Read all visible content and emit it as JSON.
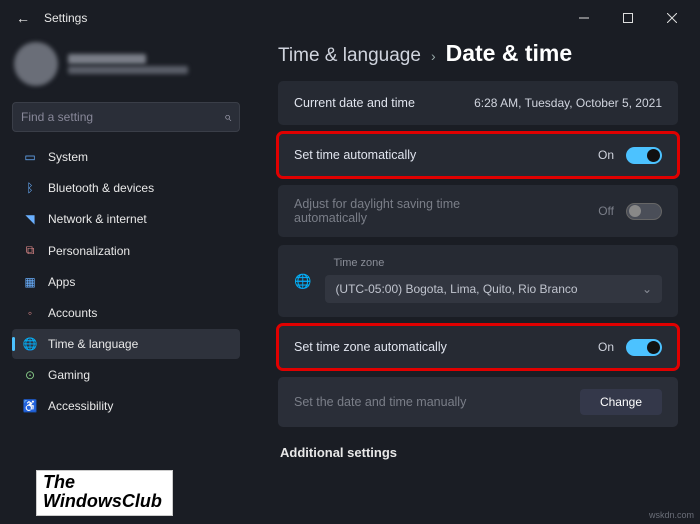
{
  "window": {
    "title": "Settings"
  },
  "search": {
    "placeholder": "Find a setting"
  },
  "sidebar": {
    "items": [
      {
        "label": "System"
      },
      {
        "label": "Bluetooth & devices"
      },
      {
        "label": "Network & internet"
      },
      {
        "label": "Personalization"
      },
      {
        "label": "Apps"
      },
      {
        "label": "Accounts"
      },
      {
        "label": "Time & language"
      },
      {
        "label": "Gaming"
      },
      {
        "label": "Accessibility"
      }
    ]
  },
  "breadcrumb": {
    "parent": "Time & language",
    "current": "Date & time"
  },
  "cards": {
    "current": {
      "label": "Current date and time",
      "value": "6:28 AM, Tuesday, October 5, 2021"
    },
    "autotime": {
      "label": "Set time automatically",
      "state": "On"
    },
    "dst": {
      "label": "Adjust for daylight saving time automatically",
      "state": "Off"
    },
    "timezone": {
      "label": "Time zone",
      "value": "(UTC-05:00) Bogota, Lima, Quito, Rio Branco"
    },
    "autozone": {
      "label": "Set time zone automatically",
      "state": "On"
    },
    "manual": {
      "label": "Set the date and time manually",
      "button": "Change"
    }
  },
  "section": {
    "additional": "Additional settings"
  },
  "watermark": {
    "line1": "The",
    "line2": "WindowsClub"
  },
  "corner": "wskdn.com"
}
